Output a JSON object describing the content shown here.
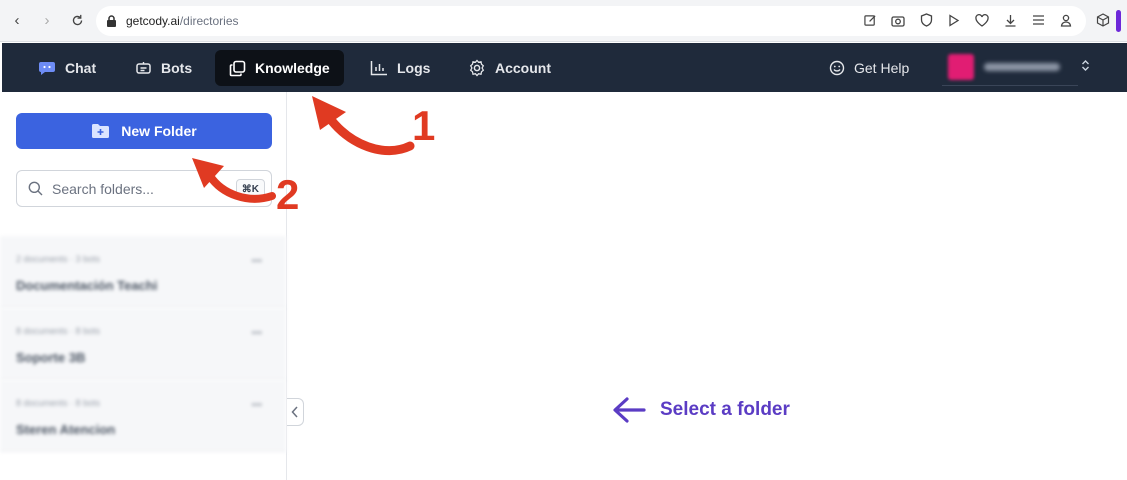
{
  "browser": {
    "url_domain": "getcody.ai",
    "url_path": "/directories"
  },
  "header": {
    "nav": [
      {
        "label": "Chat",
        "icon": "chat-bubble-icon"
      },
      {
        "label": "Bots",
        "icon": "bot-icon"
      },
      {
        "label": "Knowledge",
        "icon": "copy-icon",
        "active": true
      },
      {
        "label": "Logs",
        "icon": "chart-icon"
      },
      {
        "label": "Account",
        "icon": "gear-icon"
      }
    ],
    "help_label": "Get Help"
  },
  "sidebar": {
    "new_folder_label": "New Folder",
    "search_placeholder": "Search folders...",
    "search_shortcut": "⌘K",
    "folders": [
      {
        "meta": "2 documents · 3 bots",
        "name": "Documentación Teachi"
      },
      {
        "meta": "8 documents · 8 bots",
        "name": "Soporte 3B"
      },
      {
        "meta": "8 documents · 8 bots",
        "name": "Steren Atencion"
      }
    ]
  },
  "main": {
    "empty_label": "Select a folder"
  },
  "annotations": {
    "one": "1",
    "two": "2"
  },
  "colors": {
    "header_bg": "#1f2a3b",
    "primary_button": "#3b63e0",
    "accent_purple": "#5b3cc4",
    "annotation_red": "#e03a22"
  }
}
